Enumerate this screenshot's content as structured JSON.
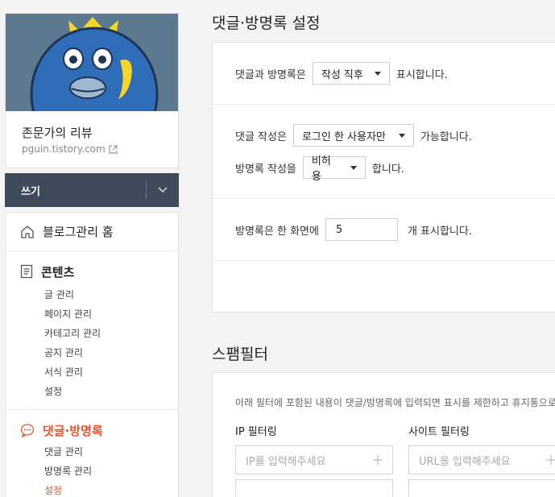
{
  "profile": {
    "blog_name": "존문가의 리뷰",
    "blog_url": "pguin.tistory.com"
  },
  "write": {
    "label": "쓰기"
  },
  "menu": {
    "home": "블로그관리 홈",
    "contents": {
      "title": "콘텐츠",
      "items": [
        "글 관리",
        "페이지 관리",
        "카테고리 관리",
        "공지 관리",
        "서식 관리",
        "설정"
      ]
    },
    "comments": {
      "title": "댓글·방명록",
      "items": [
        "댓글 관리",
        "방명록 관리",
        "설정"
      ]
    }
  },
  "settings": {
    "title": "댓글·방명록 설정",
    "display": {
      "prefix": "댓글과 방명록은",
      "selected": "작성 직후",
      "suffix": "표시합니다."
    },
    "comment_write": {
      "prefix": "댓글 작성은",
      "selected": "로그인 한 사용자만",
      "suffix": "가능합니다."
    },
    "guestbook_write": {
      "prefix": "방명록 작성을",
      "selected": "비허용",
      "suffix": "합니다."
    },
    "per_page": {
      "prefix": "방명록은 한 화면에",
      "value": "5",
      "suffix": "개 표시합니다."
    }
  },
  "spam": {
    "title": "스팸필터",
    "description": "아래 필터에 포함된 내용이 댓글/방명록에 입력되면 표시를 제한하고 휴지통으로",
    "ip_filter": {
      "title": "IP 필터링",
      "placeholder": "IP를 입력해주세요"
    },
    "site_filter": {
      "title": "사이트 필터링",
      "placeholder": "URL을 입력해주세요"
    }
  },
  "colors": {
    "accent": "#e8562f",
    "write_bar": "#3e4a5a",
    "avatar_bg": "#5c7990"
  }
}
